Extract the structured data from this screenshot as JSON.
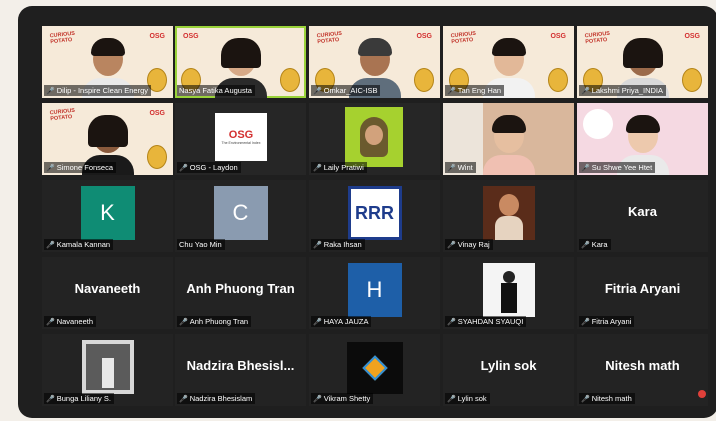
{
  "participants": [
    {
      "name": "Dilip - Inspire Clean Energy",
      "muted": false
    },
    {
      "name": "Nasya Fatika Augusta",
      "muted": null
    },
    {
      "name": "Omkar_AIC-ISB",
      "muted": true
    },
    {
      "name": "Tan Eng Han",
      "muted": true
    },
    {
      "name": "Lakshmi Priya_INDIA",
      "muted": true
    },
    {
      "name": "Simone Fonseca",
      "muted": true
    },
    {
      "name": "OSG - Laydon",
      "muted": true
    },
    {
      "name": "Laily Pratiwi",
      "muted": true
    },
    {
      "name": "Wint",
      "muted": true
    },
    {
      "name": "Su Shwe Yee Htet",
      "muted": true
    },
    {
      "name": "Kamala Kannan",
      "muted": true,
      "avatar": "K"
    },
    {
      "name": "Chu Yao Min",
      "muted": null,
      "avatar": "C"
    },
    {
      "name": "Raka Ihsan",
      "muted": true,
      "avatar": "RRR"
    },
    {
      "name": "Vinay Raj",
      "muted": true
    },
    {
      "name": "Kara",
      "muted": true,
      "display": "Kara"
    },
    {
      "name": "Navaneeth",
      "muted": true,
      "display": "Navaneeth"
    },
    {
      "name": "Anh Phuong Tran",
      "muted": true,
      "display": "Anh Phuong Tran"
    },
    {
      "name": "HAYA JAUZA",
      "muted": true,
      "avatar": "H"
    },
    {
      "name": "SYAHDAN SYAUQI",
      "muted": true
    },
    {
      "name": "Fitria Aryani",
      "muted": true,
      "display": "Fitria Aryani"
    },
    {
      "name": "Bunga Liliany S.",
      "muted": true
    },
    {
      "name": "Nadzira Bhesislam",
      "muted": true,
      "display": "Nadzira  Bhesisl..."
    },
    {
      "name": "Vikram Shetty",
      "muted": true
    },
    {
      "name": "Lylin sok",
      "muted": true,
      "display": "Lylin sok"
    },
    {
      "name": "Nitesh math",
      "muted": true,
      "display": "Nitesh math"
    }
  ],
  "brand": {
    "tag_line1": "CURIOUS",
    "tag_line2": "POTATO",
    "logo": "OSG"
  },
  "org_logo_sub": "The Environmental Index",
  "colors": {
    "active_border": "#9ad33a",
    "muted_icon": "#ff4b4b",
    "k_avatar": "#0f8c74",
    "c_avatar": "#8a9bb0",
    "h_avatar": "#1e5fa8"
  }
}
